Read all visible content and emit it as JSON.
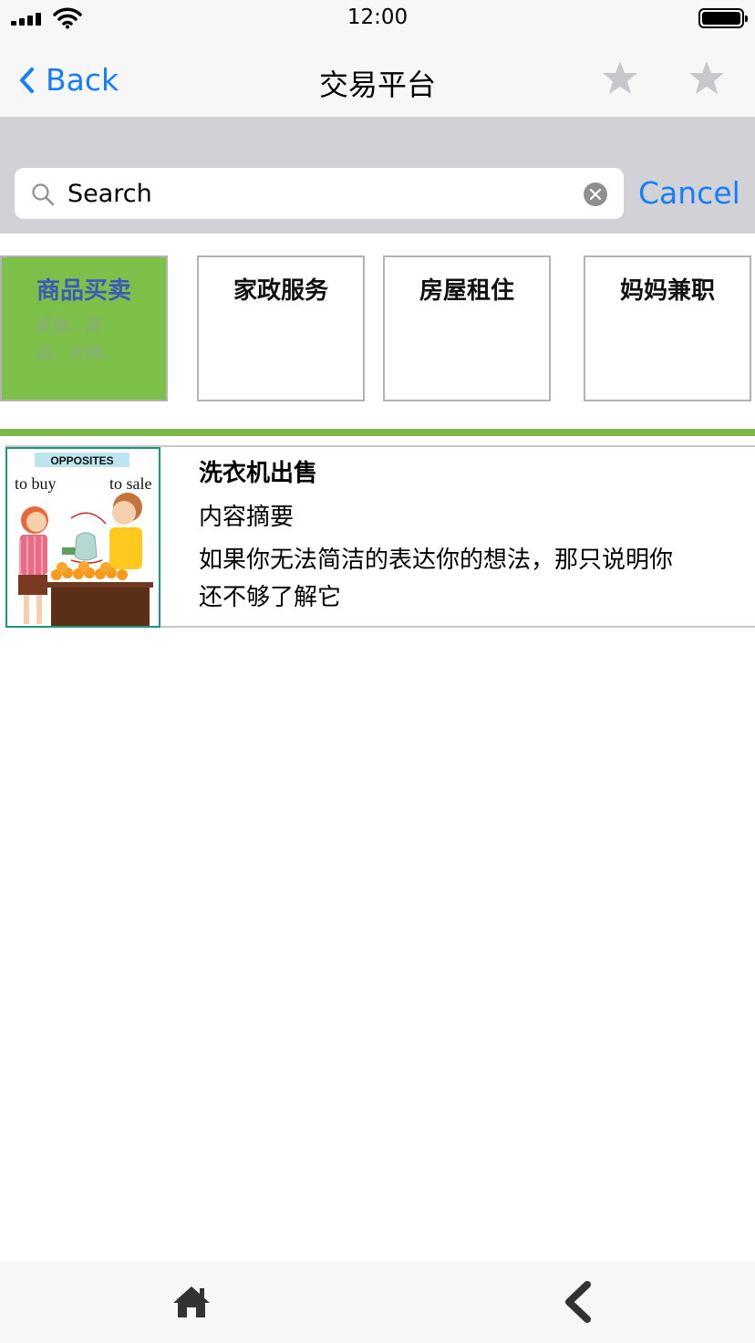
{
  "status_bar": {
    "time": "12:00"
  },
  "nav": {
    "back_label": "Back",
    "title": "交易平台"
  },
  "search": {
    "placeholder": "Search",
    "cancel_label": "Cancel"
  },
  "categories": [
    {
      "title": "商品买卖",
      "subtitle": "家电，商品，衣物，"
    },
    {
      "title": "家政服务"
    },
    {
      "title": "房屋租住"
    },
    {
      "title": "妈妈兼职"
    }
  ],
  "list": [
    {
      "title": "洗衣机出售",
      "summary": "内容摘要",
      "description": "如果你无法简洁的表达你的想法，那只说明你还不够了解它",
      "image": {
        "heading": "OPPOSITES",
        "left_label": "to buy",
        "right_label": "to sale"
      }
    }
  ],
  "colors": {
    "accent": "#147efb",
    "active_tile": "#7cc04a",
    "active_tile_text": "#3b5bb8",
    "divider": "#7cb84a"
  },
  "icons": [
    "signal-icon",
    "wifi-icon",
    "battery-icon",
    "chevron-left-icon",
    "star-icon",
    "search-icon",
    "clear-icon",
    "home-icon",
    "back-arrow-icon"
  ]
}
